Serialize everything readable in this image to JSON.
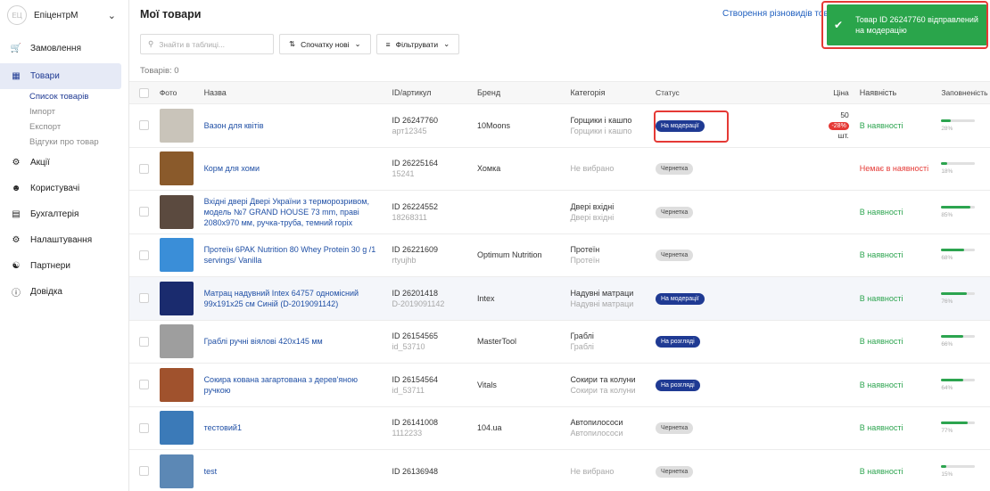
{
  "sidebar": {
    "account_name": "ЕпіцентрМ",
    "avatar": "ЕЦ",
    "items": [
      {
        "label": "Замовлення",
        "icon": "cart-icon"
      },
      {
        "label": "Товари",
        "icon": "box-icon"
      },
      {
        "label": "Акції",
        "icon": "promo-icon"
      },
      {
        "label": "Користувачі",
        "icon": "users-icon"
      },
      {
        "label": "Бухгалтерія",
        "icon": "wallet-icon"
      },
      {
        "label": "Налаштування",
        "icon": "gear-icon"
      },
      {
        "label": "Партнери",
        "icon": "handshake-icon"
      },
      {
        "label": "Довідка",
        "icon": "help-icon"
      }
    ],
    "products_sub": [
      "Список товарів",
      "Імпорт",
      "Експорт",
      "Відгуки про товар"
    ]
  },
  "main": {
    "title": "Мої товари",
    "create_link": "Створення різновидів товару",
    "search_placeholder": "Знайти в таблиці...",
    "sort_label": "Спочатку нові",
    "filter_label": "Фільтрувати",
    "count": "Товарів: 0"
  },
  "columns": {
    "photo": "Фото",
    "name": "Назва",
    "id": "ID/артикул",
    "brand": "Бренд",
    "category": "Категорія",
    "status": "Статус",
    "price": "Ціна",
    "availability": "Наявність",
    "fill": "Заповненість"
  },
  "rows": [
    {
      "name": "Вазон для квітів",
      "id": "ID 26247760",
      "sku": "арт12345",
      "brand": "10Moons",
      "category": "Горщики і кашпо",
      "category_sub": "Горщики і кашпо",
      "status": "На модерації",
      "status_type": "mod",
      "price": "50",
      "discount": "-28%",
      "unit": "шт.",
      "availability": "В наявності",
      "avail_type": "in",
      "fill": 28,
      "fill_label": "28%",
      "thumb_color": "#c9c4ba",
      "alt": false
    },
    {
      "name": "Корм для хоми",
      "id": "ID 26225164",
      "sku": "15241",
      "brand": "Хомка",
      "category": "Не вибрано",
      "category_sub": "",
      "status": "Чернетка",
      "status_type": "draft",
      "price": "",
      "discount": "",
      "unit": "",
      "availability": "Немає в наявності",
      "avail_type": "out",
      "fill": 18,
      "fill_label": "18%",
      "thumb_color": "#8a5a2b",
      "alt": false
    },
    {
      "name": "Вхідні двері Двері України з терморозривом, модель №7 GRAND HOUSE 73 mm, праві 2080x970 мм, ручка-труба, темний горіх",
      "id": "ID 26224552",
      "sku": "18268311",
      "brand": "",
      "category": "Двері вхідні",
      "category_sub": "Двері вхідні",
      "status": "Чернетка",
      "status_type": "draft",
      "price": "",
      "discount": "",
      "unit": "",
      "availability": "В наявності",
      "avail_type": "in",
      "fill": 85,
      "fill_label": "85%",
      "thumb_color": "#5b4a3f",
      "alt": false
    },
    {
      "name": "Протеїн 6PAK Nutrition 80 Whey Protein 30 g /1 servings/ Vanilla",
      "id": "ID 26221609",
      "sku": "rtyujhb",
      "brand": "Optimum Nutrition",
      "category": "Протеїн",
      "category_sub": "Протеїн",
      "status": "Чернетка",
      "status_type": "draft",
      "price": "",
      "discount": "",
      "unit": "",
      "availability": "В наявності",
      "avail_type": "in",
      "fill": 68,
      "fill_label": "68%",
      "thumb_color": "#3a8ed8",
      "alt": false
    },
    {
      "name": "Матрац надувний Intex 64757 одномісний 99x191x25 см Синій (D-2019091142)",
      "id": "ID 26201418",
      "sku": "D-2019091142",
      "brand": "Intex",
      "category": "Надувні матраци",
      "category_sub": "Надувні матраци",
      "status": "На модерації",
      "status_type": "mod",
      "price": "",
      "discount": "",
      "unit": "",
      "availability": "В наявності",
      "avail_type": "in",
      "fill": 76,
      "fill_label": "76%",
      "thumb_color": "#1a2b6e",
      "alt": true
    },
    {
      "name": "Граблі ручні віялові 420x145 мм",
      "id": "ID 26154565",
      "sku": "id_53710",
      "brand": "MasterTool",
      "category": "Граблі",
      "category_sub": "Граблі",
      "status": "На розгляді",
      "status_type": "mod",
      "price": "",
      "discount": "",
      "unit": "",
      "availability": "В наявності",
      "avail_type": "in",
      "fill": 66,
      "fill_label": "66%",
      "thumb_color": "#9e9e9e",
      "alt": false
    },
    {
      "name": "Сокира кована загартована з дерев'яною ручкою",
      "id": "ID 26154564",
      "sku": "id_53711",
      "brand": "Vitals",
      "category": "Сокири та колуни",
      "category_sub": "Сокири та колуни",
      "status": "На розгляді",
      "status_type": "mod",
      "price": "",
      "discount": "",
      "unit": "",
      "availability": "В наявності",
      "avail_type": "in",
      "fill": 64,
      "fill_label": "64%",
      "thumb_color": "#a0522d",
      "alt": false
    },
    {
      "name": "тестовий1",
      "id": "ID 26141008",
      "sku": "1112233",
      "brand": "104.ua",
      "category": "Автопилососи",
      "category_sub": "Автопилососи",
      "status": "Чернетка",
      "status_type": "draft",
      "price": "",
      "discount": "",
      "unit": "",
      "availability": "В наявності",
      "avail_type": "in",
      "fill": 77,
      "fill_label": "77%",
      "thumb_color": "#3b7ab8",
      "alt": false
    },
    {
      "name": "test",
      "id": "ID 26136948",
      "sku": "",
      "brand": "",
      "category": "Не вибрано",
      "category_sub": "",
      "status": "Чернетка",
      "status_type": "draft",
      "price": "",
      "discount": "",
      "unit": "",
      "availability": "В наявності",
      "avail_type": "in",
      "fill": 15,
      "fill_label": "15%",
      "thumb_color": "#5c88b5",
      "alt": false
    }
  ],
  "toast": {
    "message": "Товар ID 26247760 відправлений на модерацію",
    "color": "#2aa54b"
  },
  "colors": {
    "accent": "#1f3a93",
    "success": "#2ca44f",
    "danger": "#e53935",
    "link": "#1f4fa5"
  }
}
